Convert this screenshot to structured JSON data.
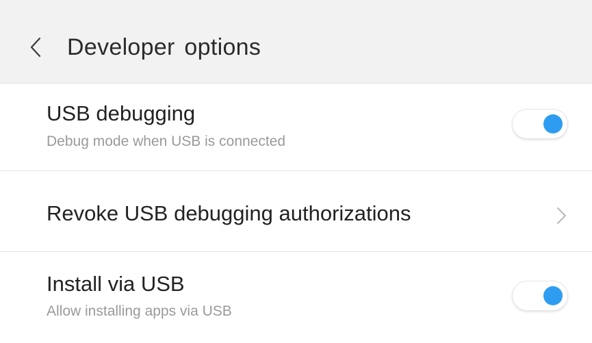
{
  "header": {
    "title": "Developer options",
    "back_icon": "chevron-left-icon",
    "background": "#f2f2f2"
  },
  "settings": [
    {
      "title": "USB debugging",
      "subtitle": "Debug mode when USB is connected",
      "control": "toggle",
      "on": true
    },
    {
      "title": "Revoke USB debugging authorizations",
      "control": "chevron",
      "icon": "chevron-right-icon"
    },
    {
      "title": "Install via USB",
      "subtitle": "Allow installing apps via USB",
      "control": "toggle",
      "on": true
    }
  ],
  "colors": {
    "accent": "#2e9df1",
    "title_text": "#222222",
    "subtitle_text": "#9a9a9a",
    "divider": "#e3e3e3"
  }
}
